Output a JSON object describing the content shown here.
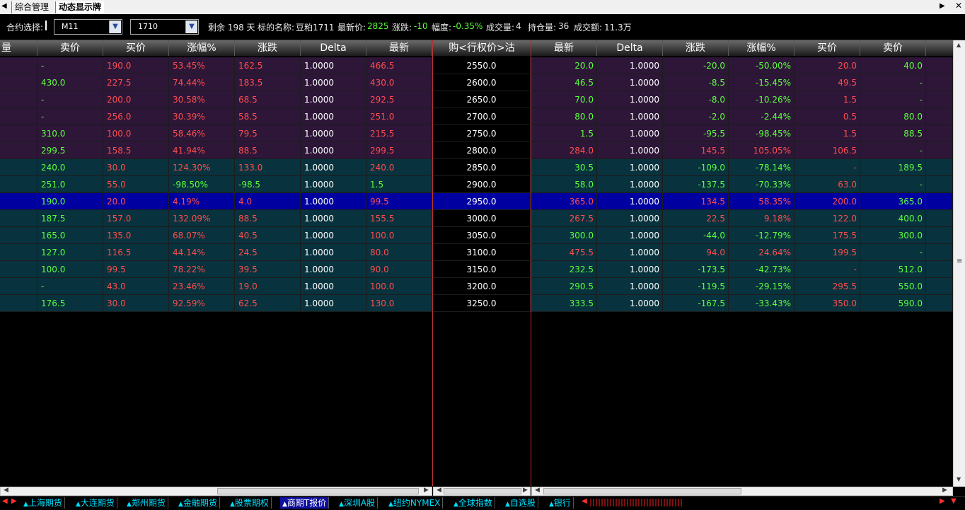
{
  "tabs": [
    "综合管理",
    "动态显示牌"
  ],
  "controls": {
    "contract_label": "合约选择:",
    "contract_value": "M11",
    "month_value": "1710",
    "remaining": "剩余 198 天",
    "underlying_label": "标的名称:",
    "underlying_value": "豆粕1711",
    "last_label": "最新价:",
    "last_value": "2825",
    "change_label": "涨跌:",
    "change_value": "-10",
    "range_label": "幅度:",
    "range_value": "-0.35%",
    "volume_label": "成交量:",
    "volume_value": "4",
    "openint_label": "持仓量:",
    "openint_value": "36",
    "turnover_label": "成交额:",
    "turnover_value": "11.3万"
  },
  "headers": {
    "call": [
      "量",
      "卖价",
      "买价",
      "涨幅%",
      "涨跌",
      "Delta",
      "最新"
    ],
    "strike": "购<行权价>沽",
    "put": [
      "最新",
      "Delta",
      "涨跌",
      "涨幅%",
      "买价",
      "卖价"
    ]
  },
  "rows": [
    {
      "bg": "p",
      "sel": false,
      "call": {
        "ask": "-",
        "bid": "190.0",
        "pct": "53.45%",
        "chg": "162.5",
        "delta": "1.0000",
        "last": "466.5",
        "c": "r"
      },
      "strike": "2550.0",
      "put": {
        "last": "20.0",
        "delta": "1.0000",
        "chg": "-20.0",
        "pct": "-50.00%",
        "bid": "20.0",
        "ask": "40.0",
        "c": "g"
      }
    },
    {
      "bg": "p",
      "sel": false,
      "call": {
        "ask": "430.0",
        "bid": "227.5",
        "pct": "74.44%",
        "chg": "183.5",
        "delta": "1.0000",
        "last": "430.0",
        "c": "r"
      },
      "strike": "2600.0",
      "put": {
        "last": "46.5",
        "delta": "1.0000",
        "chg": "-8.5",
        "pct": "-15.45%",
        "bid": "49.5",
        "ask": "-",
        "c": "g"
      }
    },
    {
      "bg": "p",
      "sel": false,
      "call": {
        "ask": "-",
        "bid": "200.0",
        "pct": "30.58%",
        "chg": "68.5",
        "delta": "1.0000",
        "last": "292.5",
        "c": "r"
      },
      "strike": "2650.0",
      "put": {
        "last": "70.0",
        "delta": "1.0000",
        "chg": "-8.0",
        "pct": "-10.26%",
        "bid": "1.5",
        "ask": "-",
        "c": "g"
      }
    },
    {
      "bg": "p",
      "sel": false,
      "call": {
        "ask": "-",
        "bid": "256.0",
        "pct": "30.39%",
        "chg": "58.5",
        "delta": "1.0000",
        "last": "251.0",
        "c": "r"
      },
      "strike": "2700.0",
      "put": {
        "last": "80.0",
        "delta": "1.0000",
        "chg": "-2.0",
        "pct": "-2.44%",
        "bid": "0.5",
        "ask": "80.0",
        "c": "g"
      }
    },
    {
      "bg": "p",
      "sel": false,
      "call": {
        "ask": "310.0",
        "bid": "100.0",
        "pct": "58.46%",
        "chg": "79.5",
        "delta": "1.0000",
        "last": "215.5",
        "c": "r"
      },
      "strike": "2750.0",
      "put": {
        "last": "1.5",
        "delta": "1.0000",
        "chg": "-95.5",
        "pct": "-98.45%",
        "bid": "1.5",
        "ask": "88.5",
        "c": "g"
      }
    },
    {
      "bg": "p",
      "sel": false,
      "call": {
        "ask": "299.5",
        "bid": "158.5",
        "pct": "41.94%",
        "chg": "88.5",
        "delta": "1.0000",
        "last": "299.5",
        "c": "r"
      },
      "strike": "2800.0",
      "put": {
        "last": "284.0",
        "delta": "1.0000",
        "chg": "145.5",
        "pct": "105.05%",
        "bid": "106.5",
        "ask": "-",
        "c": "r"
      }
    },
    {
      "bg": "t",
      "sel": false,
      "call": {
        "ask": "240.0",
        "bid": "30.0",
        "pct": "124.30%",
        "chg": "133.0",
        "delta": "1.0000",
        "last": "240.0",
        "c": "r"
      },
      "strike": "2850.0",
      "put": {
        "last": "30.5",
        "delta": "1.0000",
        "chg": "-109.0",
        "pct": "-78.14%",
        "bid": "-",
        "ask": "189.5",
        "c": "g"
      }
    },
    {
      "bg": "t",
      "sel": false,
      "call": {
        "ask": "251.0",
        "bid": "55.0",
        "pct": "-98.50%",
        "chg": "-98.5",
        "delta": "1.0000",
        "last": "1.5",
        "c": "g"
      },
      "strike": "2900.0",
      "put": {
        "last": "58.0",
        "delta": "1.0000",
        "chg": "-137.5",
        "pct": "-70.33%",
        "bid": "63.0",
        "ask": "-",
        "c": "g"
      }
    },
    {
      "bg": "s",
      "sel": true,
      "call": {
        "ask": "190.0",
        "bid": "20.0",
        "pct": "4.19%",
        "chg": "4.0",
        "delta": "1.0000",
        "last": "99.5",
        "c": "r"
      },
      "strike": "2950.0",
      "put": {
        "last": "365.0",
        "delta": "1.0000",
        "chg": "134.5",
        "pct": "58.35%",
        "bid": "200.0",
        "ask": "365.0",
        "c": "r"
      }
    },
    {
      "bg": "t",
      "sel": false,
      "call": {
        "ask": "187.5",
        "bid": "157.0",
        "pct": "132.09%",
        "chg": "88.5",
        "delta": "1.0000",
        "last": "155.5",
        "c": "r"
      },
      "strike": "3000.0",
      "put": {
        "last": "267.5",
        "delta": "1.0000",
        "chg": "22.5",
        "pct": "9.18%",
        "bid": "122.0",
        "ask": "400.0",
        "c": "r"
      }
    },
    {
      "bg": "t",
      "sel": false,
      "call": {
        "ask": "165.0",
        "bid": "135.0",
        "pct": "68.07%",
        "chg": "40.5",
        "delta": "1.0000",
        "last": "100.0",
        "c": "r"
      },
      "strike": "3050.0",
      "put": {
        "last": "300.0",
        "delta": "1.0000",
        "chg": "-44.0",
        "pct": "-12.79%",
        "bid": "175.5",
        "ask": "300.0",
        "c": "g"
      }
    },
    {
      "bg": "t",
      "sel": false,
      "call": {
        "ask": "127.0",
        "bid": "116.5",
        "pct": "44.14%",
        "chg": "24.5",
        "delta": "1.0000",
        "last": "80.0",
        "c": "r"
      },
      "strike": "3100.0",
      "put": {
        "last": "475.5",
        "delta": "1.0000",
        "chg": "94.0",
        "pct": "24.64%",
        "bid": "199.5",
        "ask": "-",
        "c": "r"
      }
    },
    {
      "bg": "t",
      "sel": false,
      "call": {
        "ask": "100.0",
        "bid": "99.5",
        "pct": "78.22%",
        "chg": "39.5",
        "delta": "1.0000",
        "last": "90.0",
        "c": "r"
      },
      "strike": "3150.0",
      "put": {
        "last": "232.5",
        "delta": "1.0000",
        "chg": "-173.5",
        "pct": "-42.73%",
        "bid": "-",
        "ask": "512.0",
        "c": "g"
      }
    },
    {
      "bg": "t",
      "sel": false,
      "call": {
        "ask": "-",
        "bid": "43.0",
        "pct": "23.46%",
        "chg": "19.0",
        "delta": "1.0000",
        "last": "100.0",
        "c": "r"
      },
      "strike": "3200.0",
      "put": {
        "last": "290.5",
        "delta": "1.0000",
        "chg": "-119.5",
        "pct": "-29.15%",
        "bid": "295.5",
        "ask": "550.0",
        "c": "g"
      }
    },
    {
      "bg": "t",
      "sel": false,
      "call": {
        "ask": "176.5",
        "bid": "30.0",
        "pct": "92.59%",
        "chg": "62.5",
        "delta": "1.0000",
        "last": "130.0",
        "c": "r"
      },
      "strike": "3250.0",
      "put": {
        "last": "333.5",
        "delta": "1.0000",
        "chg": "-167.5",
        "pct": "-33.43%",
        "bid": "350.0",
        "ask": "590.0",
        "c": "g"
      }
    }
  ],
  "bottom_tabs": [
    "上海期货",
    "大连期货",
    "郑州期货",
    "金融期货",
    "股票期权",
    "商期T报价",
    "深圳A股",
    "纽约NYMEX",
    "全球指数",
    "自选股",
    "银行"
  ],
  "bottom_active": "商期T报价",
  "colors": {
    "red": "#ff4d4d",
    "green": "#5cff3c",
    "purple_row": "#2d1638",
    "teal_row": "#08323d",
    "selected_row": "#0000a0"
  }
}
